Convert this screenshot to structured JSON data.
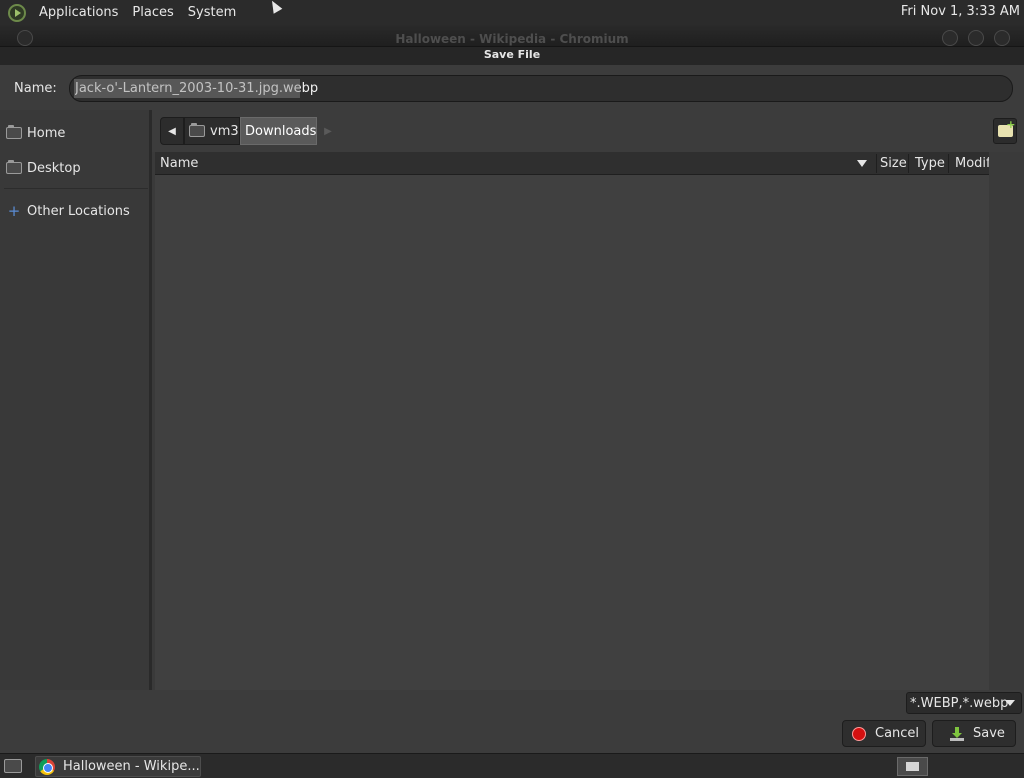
{
  "top_panel": {
    "menus": [
      "Applications",
      "Places",
      "System"
    ],
    "clock": "Fri Nov 1,  3:33 AM"
  },
  "window": {
    "title": "Halloween - Wikipedia - Chromium",
    "dialog_title": "Save File"
  },
  "name_row": {
    "label": "Name:",
    "value": "Jack-o'-Lantern_2003-10-31.jpg.webp"
  },
  "sidebar": {
    "items": [
      {
        "label": "Home",
        "icon": "folder-home-icon"
      },
      {
        "label": "Desktop",
        "icon": "folder-desktop-icon"
      },
      {
        "label": "Other Locations",
        "icon": "plus-icon"
      }
    ]
  },
  "path_bar": {
    "crumbs": [
      "vm3",
      "Downloads"
    ],
    "active": "Downloads"
  },
  "file_list": {
    "columns": [
      "Name",
      "Size",
      "Type",
      "Modif"
    ],
    "rows": []
  },
  "filter": {
    "selected": "*.WEBP,*.webp"
  },
  "buttons": {
    "cancel": "Cancel",
    "save": "Save"
  },
  "taskbar": {
    "task_label": "Halloween - Wikipe..."
  },
  "colors": {
    "accent_selected_crumb": "#5a5a5a",
    "cancel_icon": "#d41010",
    "save_icon": "#7ec33e"
  }
}
